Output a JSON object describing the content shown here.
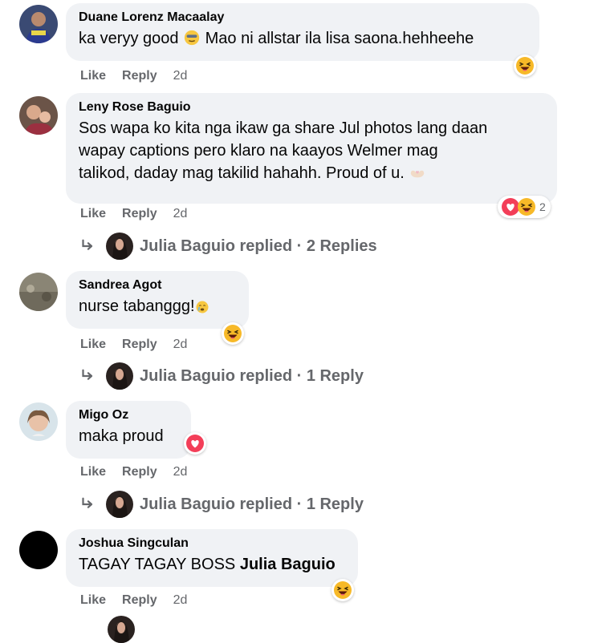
{
  "comments": [
    {
      "author": "Duane Lorenz Macaalay",
      "text_before": "ka veryy good",
      "text_after": "Mao ni allstar ila lisa saona.hehheehe",
      "like": "Like",
      "reply": "Reply",
      "time": "2d"
    },
    {
      "author": "Leny Rose Baguio",
      "line1": "Sos wapa ko kita nga ikaw ga share Jul photos lang daan",
      "line2": "wapay captions pero klaro na kaayos Welmer mag",
      "line3": "talikod, daday mag takilid hahahh. Proud of u.",
      "reaction_count": "2",
      "like": "Like",
      "reply": "Reply",
      "time": "2d",
      "replies_text": "Julia Baguio replied · 2 Replies"
    },
    {
      "author": "Sandrea Agot",
      "text": "nurse tabanggg!",
      "like": "Like",
      "reply": "Reply",
      "time": "2d",
      "replies_text": "Julia Baguio replied · 1 Reply"
    },
    {
      "author": "Migo Oz",
      "text": "maka proud",
      "like": "Like",
      "reply": "Reply",
      "time": "2d",
      "replies_text": "Julia Baguio replied · 1 Reply"
    },
    {
      "author": "Joshua Singculan",
      "text_before": "TAGAY TAGAY BOSS",
      "mention": "Julia Baguio",
      "like": "Like",
      "reply": "Reply",
      "time": "2d"
    }
  ],
  "colors": {
    "bubble": "#f0f2f5",
    "secondary_text": "#65676b",
    "haha": "#f7b928",
    "love": "#f33e58"
  }
}
